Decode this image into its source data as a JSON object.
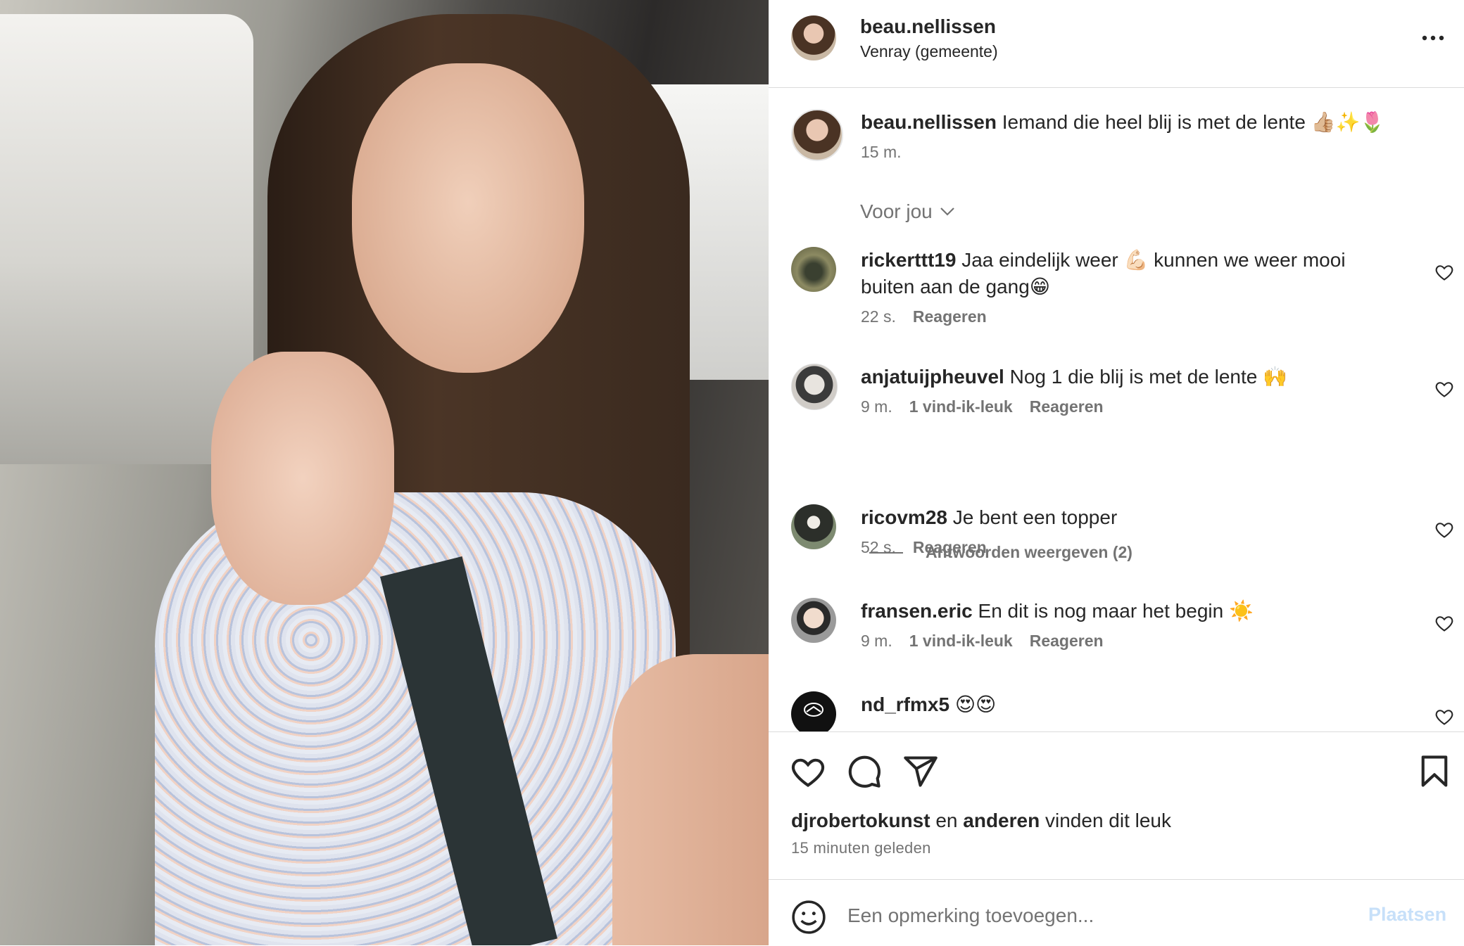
{
  "post": {
    "author": "beau.nellissen",
    "location": "Venray (gemeente)",
    "caption": "Iemand die heel blij is met de lente 👍🏼✨🌷",
    "caption_time": "15 m."
  },
  "sort_label": "Voor jou",
  "comments": [
    {
      "user": "rickerttt19",
      "text": "Jaa eindelijk weer 💪🏻 kunnen we weer mooi buiten aan de gang😁",
      "time": "22 s.",
      "likes": "",
      "reply": "Reageren",
      "avatar_color": "#6b6a4a"
    },
    {
      "user": "anjatuijpheuvel",
      "text": "Nog 1 die blij is met de lente 🙌",
      "time": "9 m.",
      "likes": "1 vind-ik-leuk",
      "reply": "Reageren",
      "avatar_color": "#d8d5d1"
    },
    {
      "user": "ricovm28",
      "text": "Je bent een topper",
      "time": "52 s.",
      "likes": "",
      "reply": "Reageren",
      "avatar_color": "#55604f"
    },
    {
      "user": "fransen.eric",
      "text": "En dit is nog maar het begin ☀️",
      "time": "9 m.",
      "likes": "1 vind-ik-leuk",
      "reply": "Reageren",
      "avatar_color": "#7a7a7a"
    },
    {
      "user": "nd_rfmx5",
      "text": "😍😍",
      "time": "",
      "likes": "",
      "reply": "",
      "avatar_color": "#111111"
    }
  ],
  "replies_toggle": "Antwoorden weergeven (2)",
  "likes_line": {
    "first": "djrobertokunst",
    "connector": "en",
    "second": "anderen",
    "suffix": "vinden dit leuk"
  },
  "post_time": "15 minuten geleden",
  "add_comment": {
    "placeholder": "Een opmerking toevoegen...",
    "post_label": "Plaatsen"
  },
  "colors": {
    "text": "#262626",
    "secondary": "#737373",
    "border": "#dbdbdb",
    "post_disabled": "#c7e0f9"
  }
}
